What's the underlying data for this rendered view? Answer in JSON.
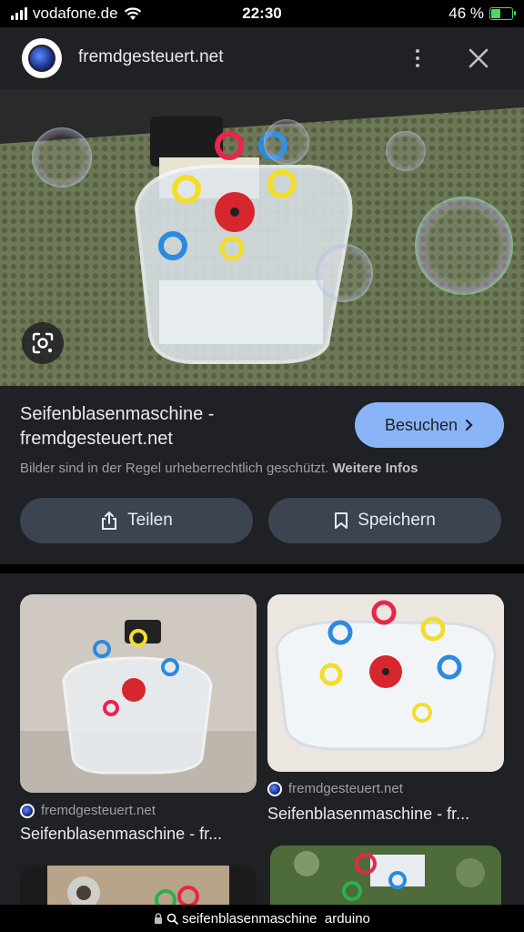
{
  "status_bar": {
    "carrier": "vodafone.de",
    "time": "22:30",
    "battery_percent_label": "46 %",
    "battery_level": 0.46,
    "signal_icon": "signal-bars-icon",
    "wifi_icon": "wifi-icon",
    "battery_icon": "battery-charging-icon"
  },
  "header": {
    "site_name": "fremdgesteuert.net",
    "menu_icon": "more-vertical-icon",
    "close_icon": "close-icon"
  },
  "hero": {
    "lens_icon": "google-lens-icon"
  },
  "result": {
    "title": "Seifenblasenmaschine - fremdgesteuert.net",
    "visit_label": "Besuchen",
    "visit_icon": "chevron-right-icon",
    "copyright_text": "Bilder sind in der Regel urheberrechtlich geschützt.",
    "more_info_label": "Weitere Infos",
    "share_label": "Teilen",
    "share_icon": "share-icon",
    "save_label": "Speichern",
    "save_icon": "bookmark-icon"
  },
  "related": [
    {
      "source": "fremdgesteuert.net",
      "title": "Seifenblasenmaschine - fr..."
    },
    {
      "source": "fremdgesteuert.net",
      "title": "Seifenblasenmaschine - fr..."
    }
  ],
  "url_bar": {
    "query": "seifenblasenmaschine  arduino",
    "lock_icon": "lock-icon",
    "search_icon": "search-icon"
  },
  "colors": {
    "accent": "#8ab4f8",
    "background": "#202124",
    "button": "#3c4452"
  }
}
